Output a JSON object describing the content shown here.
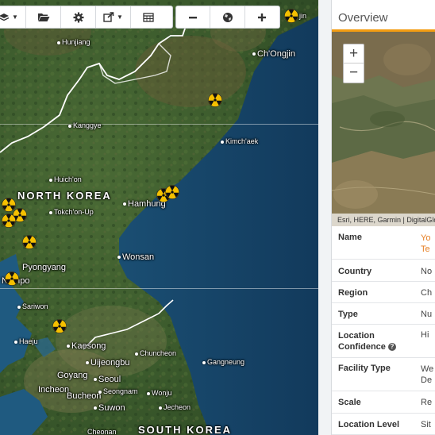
{
  "toolbar": {
    "layers_icon": "layers-icon",
    "folder_icon": "folder-open-icon",
    "settings_icon": "gear-icon",
    "share_icon": "share-icon",
    "table_icon": "table-icon",
    "zoom_out_icon": "minus-icon",
    "globe_icon": "globe-icon",
    "zoom_in_icon": "plus-icon"
  },
  "map": {
    "country_labels": [
      "NORTH KOREA",
      "SOUTH KOREA"
    ],
    "places": [
      "Hunjiang",
      "Ch'Ongjin",
      "Kanggye",
      "Kimch'aek",
      "Huich'on",
      "Hamhung",
      "Tokch'on-Up",
      "Pyongyang",
      "Nampo",
      "Wonsan",
      "Sariwon",
      "Haeju",
      "Kaesong",
      "Chuncheon",
      "Uijeongbu",
      "Goyang",
      "Seoul",
      "Gangneung",
      "Incheon",
      "Bucheon",
      "Seongnam",
      "Wonju",
      "Suwon",
      "Jecheon",
      "Cheonan",
      "jin"
    ],
    "marker_icon": "radiation-icon",
    "colors": {
      "marker_fill": "#f5c000",
      "ocean": "#1d4a6b",
      "land": "#3a5a2e"
    }
  },
  "panel": {
    "title": "Overview",
    "accent_color": "#f39c12",
    "zoom_in": "+",
    "zoom_out": "−",
    "attribution": "Esri, HERE, Garmin | DigitalGlobe",
    "rows": [
      {
        "label": "Name",
        "value": "Yo",
        "value2": "Te"
      },
      {
        "label": "Country",
        "value": "No"
      },
      {
        "label": "Region",
        "value": "Ch"
      },
      {
        "label": "Type",
        "value": "Nu"
      },
      {
        "label": "Location",
        "label2": "Confidence",
        "value": "Hi"
      },
      {
        "label": "Facility Type",
        "value": "We",
        "value2": "De"
      },
      {
        "label": "Scale",
        "value": "Re"
      },
      {
        "label": "Location Level",
        "value": "Sit"
      }
    ]
  }
}
